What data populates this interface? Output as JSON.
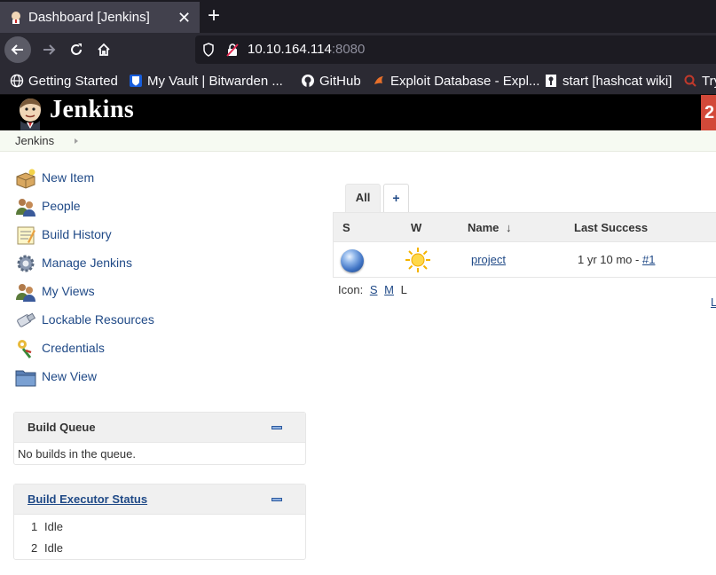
{
  "browser": {
    "tab_title": "Dashboard [Jenkins]",
    "tab_close": "✕",
    "new_tab": "+",
    "url_host": "10.10.164.114",
    "url_port": ":8080",
    "bookmarks": [
      {
        "label": "Getting Started",
        "icon": "globe-icon"
      },
      {
        "label": "My Vault | Bitwarden ...",
        "icon": "bitwarden-icon"
      },
      {
        "label": "GitHub",
        "icon": "github-icon"
      },
      {
        "label": "Exploit Database - Expl...",
        "icon": "exploit-db-icon"
      },
      {
        "label": "start [hashcat wiki]",
        "icon": "hashcat-icon"
      },
      {
        "label": "Try",
        "icon": "search-icon"
      }
    ]
  },
  "header": {
    "title": "Jenkins",
    "badge": "2"
  },
  "breadcrumb": {
    "root": "Jenkins"
  },
  "sidebar": {
    "tasks": [
      {
        "label": "New Item",
        "icon": "new-item-icon"
      },
      {
        "label": "People",
        "icon": "people-icon"
      },
      {
        "label": "Build History",
        "icon": "notepad-icon"
      },
      {
        "label": "Manage Jenkins",
        "icon": "gear-icon"
      },
      {
        "label": "My Views",
        "icon": "user-icon"
      },
      {
        "label": "Lockable Resources",
        "icon": "usb-icon"
      },
      {
        "label": "Credentials",
        "icon": "keys-icon"
      },
      {
        "label": "New View",
        "icon": "folder-icon"
      }
    ]
  },
  "build_queue": {
    "title": "Build Queue",
    "empty_text": "No builds in the queue."
  },
  "executors": {
    "title": "Build Executor Status",
    "rows": [
      {
        "num": "1",
        "status": "Idle"
      },
      {
        "num": "2",
        "status": "Idle"
      }
    ]
  },
  "view": {
    "tab_all": "All",
    "tab_add": "+",
    "columns": {
      "s": "S",
      "w": "W",
      "name": "Name",
      "sort_arrow": "↓",
      "last_success": "Last Success"
    },
    "jobs": [
      {
        "name": "project",
        "last_success_time": "1 yr 10 mo - ",
        "last_success_build": "#1",
        "status": "blue",
        "weather": "sunny"
      }
    ],
    "icon_label": "Icon:",
    "icon_sizes": [
      "S",
      "M",
      "L"
    ],
    "cut_link": "L"
  },
  "colors": {
    "link": "#204a87",
    "header_bg": "#000000",
    "badge_bg": "#d24939",
    "breadcrumb_bg": "#f6faf2"
  }
}
